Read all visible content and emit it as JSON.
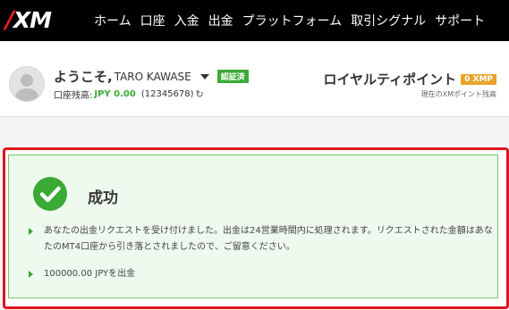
{
  "header": {
    "logo": "XM",
    "nav": [
      "ホーム",
      "口座",
      "入金",
      "出金",
      "プラットフォーム",
      "取引シグナル",
      "サポート"
    ]
  },
  "welcome": {
    "greeting": "ようこそ,",
    "name": "TARO KAWASE",
    "verified_badge": "認証済",
    "balance_label": "口座残高:",
    "balance_value": "JPY 0.00",
    "account_number": "(12345678)"
  },
  "loyalty": {
    "title": "ロイヤルティポイント",
    "badge": "0 XMP",
    "subtitle": "現在のXMポイント残高"
  },
  "success": {
    "title": "成功",
    "messages": [
      "あなたの出金リクエストを受け付けました。出金は24営業時間内に処理されます。リクエストされた金額はあなたのMT4口座から引き落とされましたので、ご留意ください。",
      "100000.00 JPYを出金"
    ]
  },
  "colors": {
    "brand_red": "#e21f26",
    "success_green": "#3aa935",
    "xmp_orange": "#e8a32c",
    "highlight_red": "#e0141f"
  },
  "icons": {
    "avatar": "user-avatar-icon",
    "caret": "chevron-down-icon",
    "refresh": "refresh-icon",
    "check": "check-circle-icon",
    "bullet": "triangle-right-icon"
  }
}
